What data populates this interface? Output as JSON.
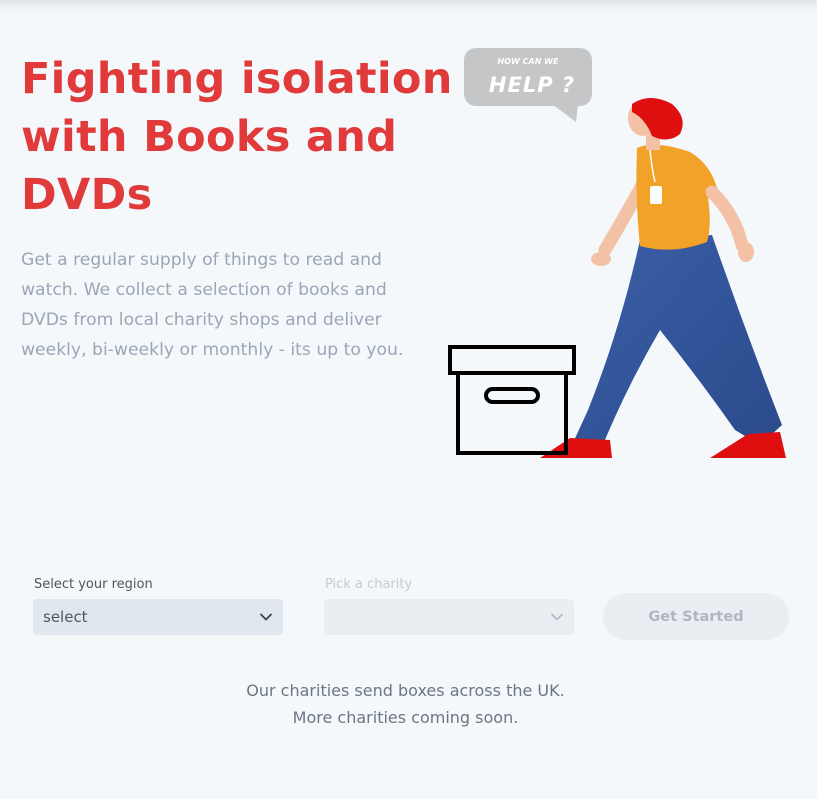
{
  "hero": {
    "title_lines": [
      "Fighting isolation",
      "with Books and",
      "DVDs"
    ],
    "description_lines": [
      "Get a regular supply of things to read and",
      "watch. We collect a selection of books and",
      "DVDs from local charity shops and deliver",
      "weekly, bi-weekly or monthly - its up to you."
    ]
  },
  "illustration": {
    "bubble_small": "HOW CAN WE",
    "bubble_big": "HELP ?"
  },
  "form": {
    "region_label": "Select your region",
    "region_value": "select",
    "charity_label": "Pick a charity",
    "charity_value": "",
    "get_started_label": "Get Started"
  },
  "footer": {
    "lines": [
      "Our charities send boxes across the UK.",
      "More charities coming soon."
    ]
  },
  "colors": {
    "accent": "#e03a3a",
    "background": "#f5f8fb",
    "muted_text": "#9aa6b6"
  },
  "icons": [
    "speech-bubble-icon",
    "box-icon",
    "chevron-down-icon"
  ]
}
